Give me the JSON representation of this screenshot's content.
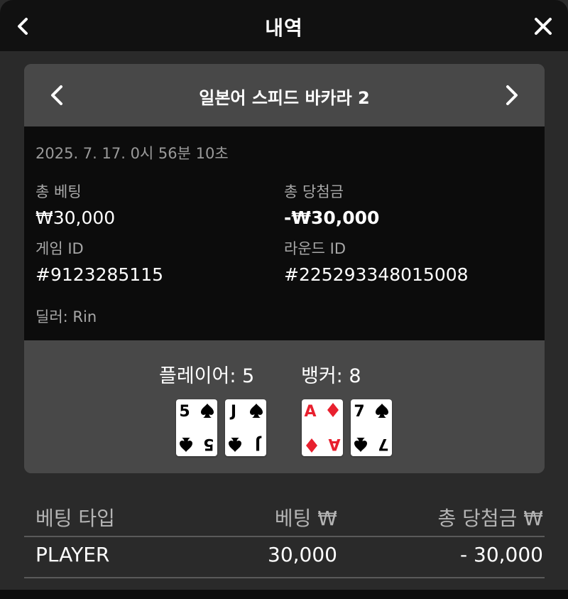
{
  "header": {
    "title": "내역",
    "back_icon": "chevron-left-icon",
    "close_icon": "close-icon"
  },
  "game": {
    "name": "일본어 스피드 바카라 2",
    "prev_icon": "chevron-left-icon",
    "next_icon": "chevron-right-icon"
  },
  "details": {
    "timestamp": "2025. 7. 17. 0시 56분 10초",
    "total_bet_label": "총 베팅",
    "total_bet_value": "₩30,000",
    "total_win_label": "총 당첨금",
    "total_win_value": "-₩30,000",
    "game_id_label": "게임 ID",
    "game_id_value": "#9123285115",
    "round_id_label": "라운드 ID",
    "round_id_value": "#225293348015008",
    "dealer": "딜러: Rin"
  },
  "result": {
    "player_score": "플레이어: 5",
    "banker_score": "뱅커: 8",
    "player_cards": [
      {
        "rank": "5",
        "suit": "spade",
        "color": "#000000"
      },
      {
        "rank": "J",
        "suit": "spade",
        "color": "#000000"
      }
    ],
    "banker_cards": [
      {
        "rank": "A",
        "suit": "diamond",
        "color": "#e8202e"
      },
      {
        "rank": "7",
        "suit": "spade",
        "color": "#000000"
      }
    ]
  },
  "table": {
    "headers": [
      "베팅 타입",
      "베팅 ₩",
      "총 당첨금 ₩"
    ],
    "rows": [
      {
        "type": "PLAYER",
        "bet": "30,000",
        "win": "- 30,000"
      }
    ]
  },
  "colors": {
    "background": "#2a2a2a",
    "header_bg": "#111111",
    "panel_bg": "#484848",
    "details_bg": "#0c0c0c",
    "red_suit": "#e8202e"
  }
}
